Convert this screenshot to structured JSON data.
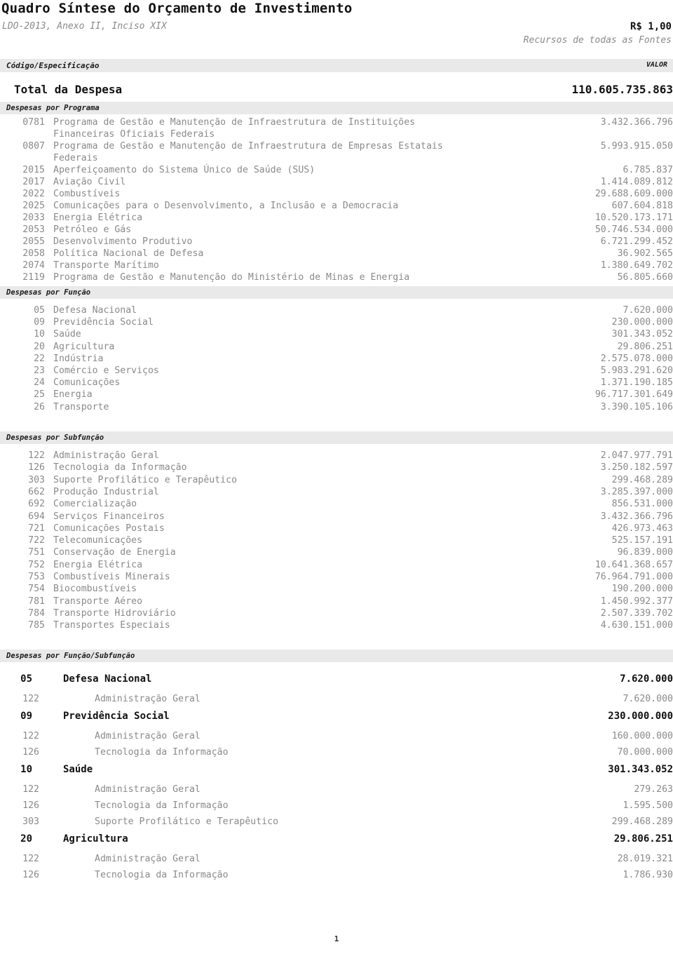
{
  "header": {
    "title": "Quadro Síntese do Orçamento de Investimento",
    "subtitle": "LDO-2013, Anexo II, Inciso XIX",
    "unit_value": "R$ 1,00",
    "unit_sources": "Recursos de todas as Fontes"
  },
  "columns": {
    "left": "Código/Especificação",
    "right": "VALOR"
  },
  "total": {
    "label": "Total da Despesa",
    "value": "110.605.735.863"
  },
  "sections": {
    "programa": {
      "band": "Despesas por Programa",
      "rows": [
        {
          "code": "0781",
          "desc": "Programa de Gestão e Manutenção de Infraestrutura de Instituições",
          "desc2": "Financeiras Oficiais Federais",
          "value": "3.432.366.796"
        },
        {
          "code": "0807",
          "desc": "Programa de Gestão e Manutenção de Infraestrutura de Empresas Estatais",
          "desc2": "Federais",
          "value": "5.993.915.050"
        },
        {
          "code": "2015",
          "desc": "Aperfeiçoamento do Sistema Único de Saúde (SUS)",
          "desc2": "",
          "value": "6.785.837"
        },
        {
          "code": "2017",
          "desc": "Aviação Civil",
          "desc2": "",
          "value": "1.414.089.812"
        },
        {
          "code": "2022",
          "desc": "Combustíveis",
          "desc2": "",
          "value": "29.688.609.000"
        },
        {
          "code": "2025",
          "desc": "Comunicações para o Desenvolvimento, a Inclusão e a Democracia",
          "desc2": "",
          "value": "607.604.818"
        },
        {
          "code": "2033",
          "desc": "Energia Elétrica",
          "desc2": "",
          "value": "10.520.173.171"
        },
        {
          "code": "2053",
          "desc": "Petróleo e Gás",
          "desc2": "",
          "value": "50.746.534.000"
        },
        {
          "code": "2055",
          "desc": "Desenvolvimento Produtivo",
          "desc2": "",
          "value": "6.721.299.452"
        },
        {
          "code": "2058",
          "desc": "Política Nacional de Defesa",
          "desc2": "",
          "value": "36.902.565"
        },
        {
          "code": "2074",
          "desc": "Transporte Marítimo",
          "desc2": "",
          "value": "1.380.649.702"
        },
        {
          "code": "2119",
          "desc": "Programa de Gestão e Manutenção do Ministério de Minas e Energia",
          "desc2": "",
          "value": "56.805.660"
        }
      ]
    },
    "funcao": {
      "band": "Despesas por Função",
      "rows": [
        {
          "code": "05",
          "desc": "Defesa Nacional",
          "value": "7.620.000"
        },
        {
          "code": "09",
          "desc": "Previdência Social",
          "value": "230.000.000"
        },
        {
          "code": "10",
          "desc": "Saúde",
          "value": "301.343.052"
        },
        {
          "code": "20",
          "desc": "Agricultura",
          "value": "29.806.251"
        },
        {
          "code": "22",
          "desc": "Indústria",
          "value": "2.575.078.000"
        },
        {
          "code": "23",
          "desc": "Comércio e Serviços",
          "value": "5.983.291.620"
        },
        {
          "code": "24",
          "desc": "Comunicações",
          "value": "1.371.190.185"
        },
        {
          "code": "25",
          "desc": "Energia",
          "value": "96.717.301.649"
        },
        {
          "code": "26",
          "desc": "Transporte",
          "value": "3.390.105.106"
        }
      ]
    },
    "subfuncao": {
      "band": "Despesas por Subfunção",
      "rows": [
        {
          "code": "122",
          "desc": "Administração Geral",
          "value": "2.047.977.791"
        },
        {
          "code": "126",
          "desc": "Tecnologia da Informação",
          "value": "3.250.182.597"
        },
        {
          "code": "303",
          "desc": "Suporte Profilático e Terapêutico",
          "value": "299.468.289"
        },
        {
          "code": "662",
          "desc": "Produção Industrial",
          "value": "3.285.397.000"
        },
        {
          "code": "692",
          "desc": "Comercialização",
          "value": "856.531.000"
        },
        {
          "code": "694",
          "desc": "Serviços Financeiros",
          "value": "3.432.366.796"
        },
        {
          "code": "721",
          "desc": "Comunicações Postais",
          "value": "426.973.463"
        },
        {
          "code": "722",
          "desc": "Telecomunicações",
          "value": "525.157.191"
        },
        {
          "code": "751",
          "desc": "Conservação de Energia",
          "value": "96.839.000"
        },
        {
          "code": "752",
          "desc": "Energia Elétrica",
          "value": "10.641.368.657"
        },
        {
          "code": "753",
          "desc": "Combustíveis Minerais",
          "value": "76.964.791.000"
        },
        {
          "code": "754",
          "desc": "Biocombustíveis",
          "value": "190.200.000"
        },
        {
          "code": "781",
          "desc": "Transporte Aéreo",
          "value": "1.450.992.377"
        },
        {
          "code": "784",
          "desc": "Transporte Hidroviário",
          "value": "2.507.339.702"
        },
        {
          "code": "785",
          "desc": "Transportes Especiais",
          "value": "4.630.151.000"
        }
      ]
    },
    "funcao_subfuncao": {
      "band": "Despesas por Função/Subfunção",
      "rows": [
        {
          "kind": "fn",
          "code": "05",
          "desc": "Defesa Nacional",
          "value": "7.620.000"
        },
        {
          "kind": "sfn",
          "code": "122",
          "desc": "Administração Geral",
          "value": "7.620.000"
        },
        {
          "kind": "fn",
          "code": "09",
          "desc": "Previdência Social",
          "value": "230.000.000"
        },
        {
          "kind": "sfn",
          "code": "122",
          "desc": "Administração Geral",
          "value": "160.000.000"
        },
        {
          "kind": "sfn",
          "code": "126",
          "desc": "Tecnologia da Informação",
          "value": "70.000.000"
        },
        {
          "kind": "fn",
          "code": "10",
          "desc": "Saúde",
          "value": "301.343.052"
        },
        {
          "kind": "sfn",
          "code": "122",
          "desc": "Administração Geral",
          "value": "279.263"
        },
        {
          "kind": "sfn",
          "code": "126",
          "desc": "Tecnologia da Informação",
          "value": "1.595.500"
        },
        {
          "kind": "sfn",
          "code": "303",
          "desc": "Suporte Profilático e Terapêutico",
          "value": "299.468.289"
        },
        {
          "kind": "fn",
          "code": "20",
          "desc": "Agricultura",
          "value": "29.806.251"
        },
        {
          "kind": "sfn",
          "code": "122",
          "desc": "Administração Geral",
          "value": "28.019.321"
        },
        {
          "kind": "sfn",
          "code": "126",
          "desc": "Tecnologia da Informação",
          "value": "1.786.930"
        }
      ]
    }
  },
  "footer": {
    "page_number": "1"
  }
}
